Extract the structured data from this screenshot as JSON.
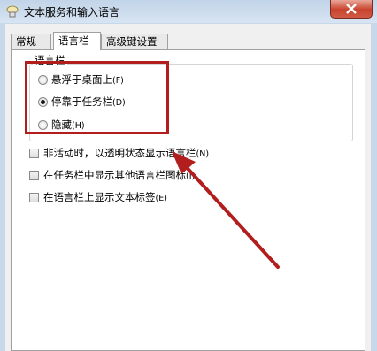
{
  "window": {
    "title": "文本服务和输入语言",
    "close_icon": "close-icon"
  },
  "tabs": [
    {
      "label": "常规"
    },
    {
      "label": "语言栏",
      "active": true
    },
    {
      "label": "高级键设置"
    }
  ],
  "language_bar_group": {
    "title": "语言栏",
    "options": [
      {
        "label": "悬浮于桌面上",
        "accel": "(F)",
        "checked": false
      },
      {
        "label": "停靠于任务栏",
        "accel": "(D)",
        "checked": true
      },
      {
        "label": "隐藏",
        "accel": "(H)",
        "checked": false
      }
    ]
  },
  "checkboxes": [
    {
      "label": "非活动时，以透明状态显示语言栏",
      "accel": "(N)",
      "checked": false
    },
    {
      "label": "在任务栏中显示其他语言栏图标",
      "accel": "(I)",
      "checked": false
    },
    {
      "label": "在语言栏上显示文本标签",
      "accel": "(E)",
      "checked": false
    }
  ],
  "annotation_color": "#b21e1e"
}
